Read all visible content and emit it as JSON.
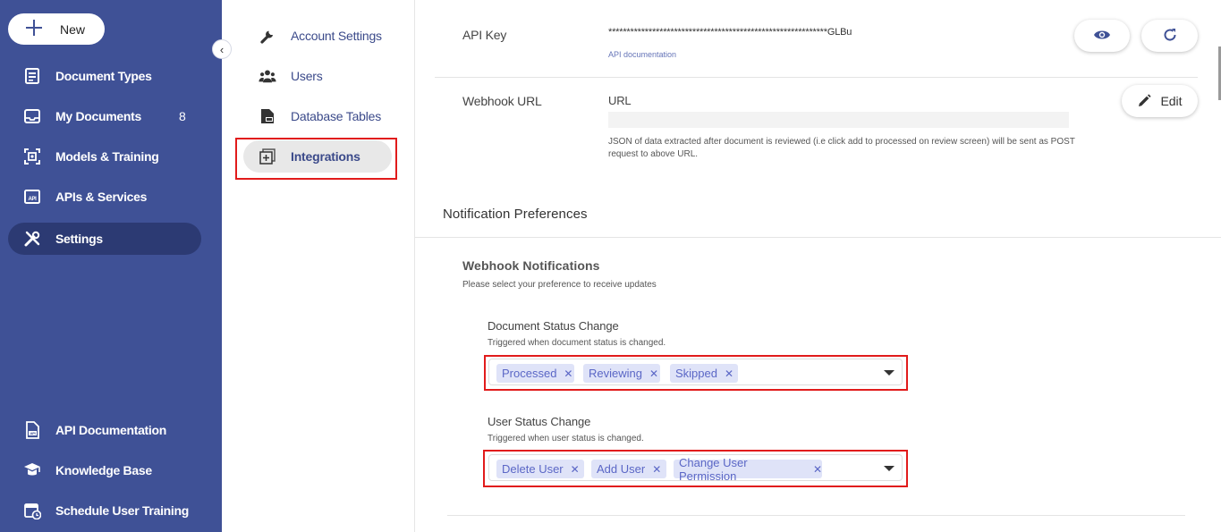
{
  "sidebar": {
    "new_label": "New",
    "collapse_icon": "‹",
    "items": [
      {
        "label": "Document Types",
        "icon": "document-types-icon"
      },
      {
        "label": "My Documents",
        "icon": "inbox-icon",
        "badge": "8"
      },
      {
        "label": "Models & Training",
        "icon": "models-icon"
      },
      {
        "label": "APIs & Services",
        "icon": "api-icon"
      },
      {
        "label": "Settings",
        "icon": "tools-icon",
        "active": true
      }
    ],
    "bottom_items": [
      {
        "label": "API Documentation",
        "icon": "api-doc-icon"
      },
      {
        "label": "Knowledge Base",
        "icon": "graduation-cap-icon"
      },
      {
        "label": "Schedule User Training",
        "icon": "calendar-clock-icon"
      }
    ]
  },
  "settings_nav": [
    {
      "label": "Account Settings",
      "icon": "wrench-icon"
    },
    {
      "label": "Users",
      "icon": "users-icon"
    },
    {
      "label": "Database Tables",
      "icon": "database-table-icon"
    },
    {
      "label": "Integrations",
      "icon": "integrations-icon",
      "active": true
    }
  ],
  "api_key": {
    "label": "API Key",
    "masked_value": "************************************************************GLBu",
    "doc_link": "API documentation",
    "view_icon": "eye-icon",
    "refresh_icon": "refresh-icon"
  },
  "webhook": {
    "label": "Webhook URL",
    "field_label": "URL",
    "value": "",
    "hint": "JSON of data extracted after document is reviewed (i.e click add to processed on review screen) will be sent as POST request to above URL.",
    "edit_label": "Edit",
    "edit_icon": "pencil-icon"
  },
  "notifications": {
    "title": "Notification Preferences",
    "webhook_title": "Webhook Notifications",
    "webhook_subtitle": "Please select your preference to receive updates",
    "document_status": {
      "label": "Document Status Change",
      "hint": "Triggered when document status is changed.",
      "chips": [
        "Processed",
        "Reviewing",
        "Skipped"
      ]
    },
    "user_status": {
      "label": "User Status Change",
      "hint": "Triggered when user status is changed.",
      "chips": [
        "Delete User",
        "Add User",
        "Change User Permission"
      ]
    }
  },
  "colors": {
    "sidebar": "#3f5196",
    "sidebar_active": "#2c3a73",
    "highlight": "#e11b1b",
    "chip_bg": "#dfe3f8",
    "chip_text": "#5b67c6"
  }
}
